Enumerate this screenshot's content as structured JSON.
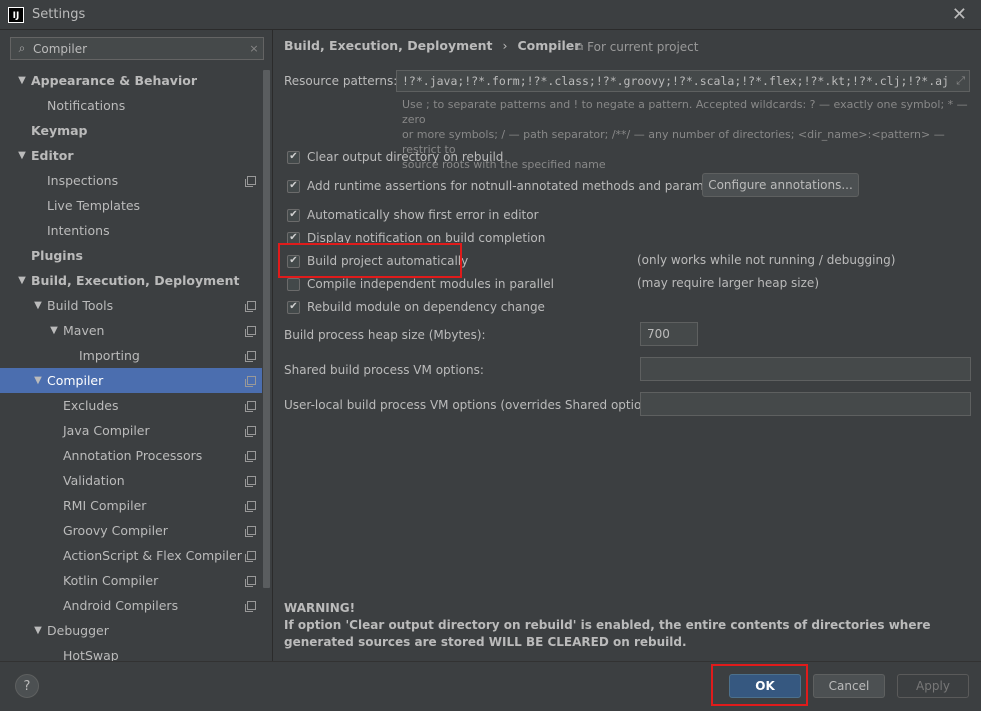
{
  "window": {
    "title": "Settings",
    "app_icon_text": "IJ"
  },
  "search": {
    "value": "Compiler",
    "clear_glyph": "×"
  },
  "tree": [
    {
      "label": "Appearance & Behavior",
      "bold": true,
      "level": 0,
      "arrow": "▼",
      "copy": false
    },
    {
      "label": "Notifications",
      "bold": false,
      "level": 1,
      "arrow": "",
      "copy": false
    },
    {
      "label": "Keymap",
      "bold": true,
      "level": 0,
      "arrow": "",
      "copy": false
    },
    {
      "label": "Editor",
      "bold": true,
      "level": 0,
      "arrow": "▼",
      "copy": false
    },
    {
      "label": "Inspections",
      "bold": false,
      "level": 1,
      "arrow": "",
      "copy": true
    },
    {
      "label": "Live Templates",
      "bold": false,
      "level": 1,
      "arrow": "",
      "copy": false
    },
    {
      "label": "Intentions",
      "bold": false,
      "level": 1,
      "arrow": "",
      "copy": false
    },
    {
      "label": "Plugins",
      "bold": true,
      "level": 0,
      "arrow": "",
      "copy": false
    },
    {
      "label": "Build, Execution, Deployment",
      "bold": true,
      "level": 0,
      "arrow": "▼",
      "copy": false
    },
    {
      "label": "Build Tools",
      "bold": false,
      "level": 1,
      "arrow": "▼",
      "copy": true
    },
    {
      "label": "Maven",
      "bold": false,
      "level": 2,
      "arrow": "▼",
      "copy": true
    },
    {
      "label": "Importing",
      "bold": false,
      "level": 3,
      "arrow": "",
      "copy": true
    },
    {
      "label": "Compiler",
      "bold": false,
      "level": 1,
      "arrow": "▼",
      "copy": true,
      "selected": true
    },
    {
      "label": "Excludes",
      "bold": false,
      "level": 2,
      "arrow": "",
      "copy": true
    },
    {
      "label": "Java Compiler",
      "bold": false,
      "level": 2,
      "arrow": "",
      "copy": true
    },
    {
      "label": "Annotation Processors",
      "bold": false,
      "level": 2,
      "arrow": "",
      "copy": true
    },
    {
      "label": "Validation",
      "bold": false,
      "level": 2,
      "arrow": "",
      "copy": true
    },
    {
      "label": "RMI Compiler",
      "bold": false,
      "level": 2,
      "arrow": "",
      "copy": true
    },
    {
      "label": "Groovy Compiler",
      "bold": false,
      "level": 2,
      "arrow": "",
      "copy": true
    },
    {
      "label": "ActionScript & Flex Compiler",
      "bold": false,
      "level": 2,
      "arrow": "",
      "copy": true
    },
    {
      "label": "Kotlin Compiler",
      "bold": false,
      "level": 2,
      "arrow": "",
      "copy": true
    },
    {
      "label": "Android Compilers",
      "bold": false,
      "level": 2,
      "arrow": "",
      "copy": true
    },
    {
      "label": "Debugger",
      "bold": false,
      "level": 1,
      "arrow": "▼",
      "copy": false
    },
    {
      "label": "HotSwap",
      "bold": false,
      "level": 2,
      "arrow": "",
      "copy": false
    }
  ],
  "breadcrumb": {
    "parent": "Build, Execution, Deployment",
    "sep": "›",
    "current": "Compiler"
  },
  "for_project": "For current project",
  "resource": {
    "label": "Resource patterns:",
    "value": "!?*.java;!?*.form;!?*.class;!?*.groovy;!?*.scala;!?*.flex;!?*.kt;!?*.clj;!?*.aj",
    "hint_line1": "Use ; to separate patterns and ! to negate a pattern. Accepted wildcards: ? — exactly one symbol; * — zero",
    "hint_line2": "or more symbols; / — path separator; /**/ — any number of directories; <dir_name>:<pattern> — restrict to",
    "hint_line3": "source roots with the specified name"
  },
  "options": {
    "clear_output": {
      "label": "Clear output directory on rebuild",
      "checked": true
    },
    "add_assertions": {
      "label": "Add runtime assertions for notnull-annotated methods and parameters",
      "checked": true
    },
    "show_first_error": {
      "label": "Automatically show first error in editor",
      "checked": true
    },
    "display_notification": {
      "label": "Display notification on build completion",
      "checked": true
    },
    "build_automatically": {
      "label": "Build project automatically",
      "checked": true,
      "note": "(only works while not running / debugging)"
    },
    "compile_parallel": {
      "label": "Compile independent modules in parallel",
      "checked": false,
      "note": "(may require larger heap size)"
    },
    "rebuild_dependency": {
      "label": "Rebuild module on dependency change",
      "checked": true
    }
  },
  "configure_annotations_label": "Configure annotations...",
  "heap": {
    "label": "Build process heap size (Mbytes):",
    "value": "700"
  },
  "shared_vm": {
    "label": "Shared build process VM options:",
    "value": ""
  },
  "user_vm": {
    "label": "User-local build process VM options (overrides Shared options):",
    "value": ""
  },
  "warning": {
    "title": "WARNING!",
    "text": "If option 'Clear output directory on rebuild' is enabled, the entire contents of directories where generated sources are stored WILL BE CLEARED on rebuild."
  },
  "buttons": {
    "help": "?",
    "ok": "OK",
    "cancel": "Cancel",
    "apply": "Apply"
  },
  "colors": {
    "selection": "#4b6eaf",
    "highlight": "#e01b1b",
    "ok": "#365880"
  }
}
